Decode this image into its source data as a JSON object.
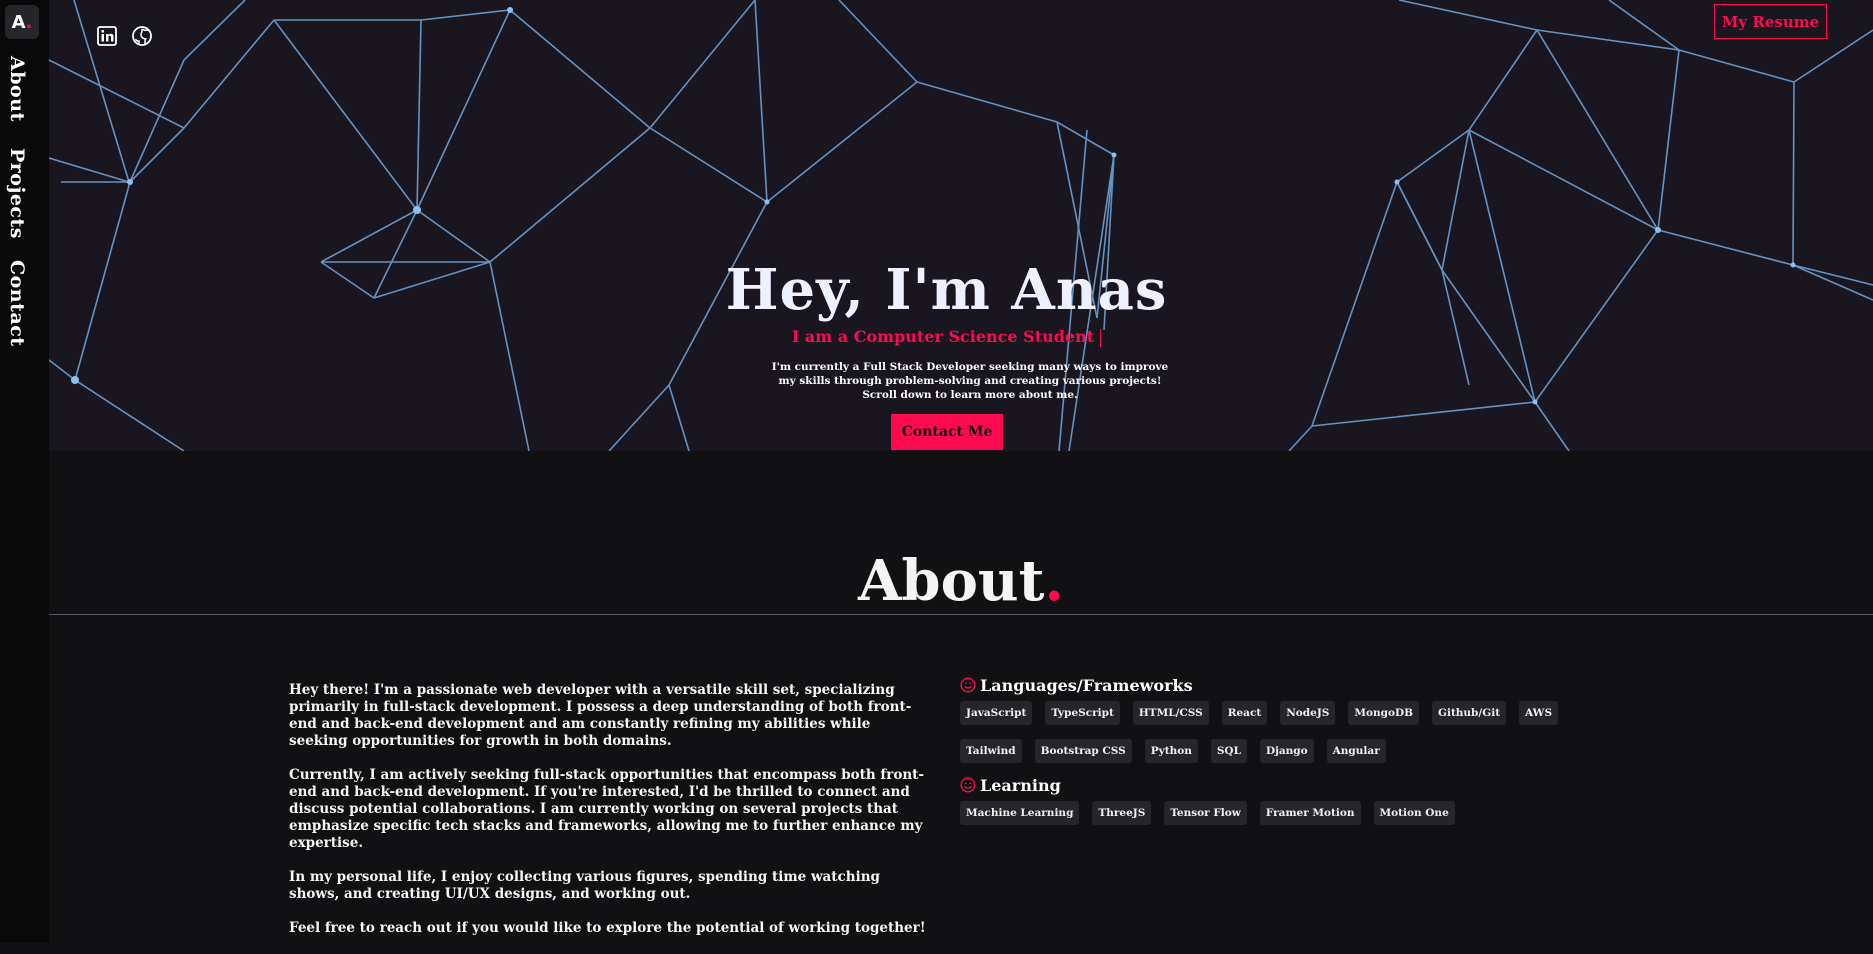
{
  "sidebar": {
    "logo_letter": "A",
    "logo_dot": ".",
    "links": [
      "About",
      "Projects",
      "Contact"
    ]
  },
  "header": {
    "resume_label": "My Resume",
    "social_icons": [
      "linkedin-icon",
      "github-icon"
    ]
  },
  "hero": {
    "title": "Hey, I'm Anas",
    "subtitle": "I am a Computer Science Student",
    "description_lines": [
      "I'm currently a Full Stack Developer seeking many ways to improve",
      "my skills through problem-solving and creating various projects!",
      "Scroll down to learn more about me."
    ],
    "contact_label": "Contact Me"
  },
  "about": {
    "title": "About",
    "title_dot": ".",
    "paragraphs": [
      "Hey there! I'm a passionate web developer with a versatile skill set, specializing primarily in full-stack development. I possess a deep understanding of both front-end and back-end development and am constantly refining my abilities while seeking opportunities for growth in both domains.",
      "Currently, I am actively seeking full-stack opportunities that encompass both front-end and back-end development. If you're interested, I'd be thrilled to connect and discuss potential collaborations. I am currently working on several projects that emphasize specific tech stacks and frameworks, allowing me to further enhance my expertise.",
      "In my personal life, I enjoy collecting various figures, spending time watching shows, and creating UI/UX designs, and working out.",
      "Feel free to reach out if you would like to explore the potential of working together!"
    ],
    "skills": {
      "languages_title": "Languages/Frameworks",
      "languages": [
        "JavaScript",
        "TypeScript",
        "HTML/CSS",
        "React",
        "NodeJS",
        "MongoDB",
        "Github/Git",
        "AWS",
        "Tailwind",
        "Bootstrap CSS",
        "Python",
        "SQL",
        "Django",
        "Angular"
      ],
      "learning_title": "Learning",
      "learning": [
        "Machine Learning",
        "ThreeJS",
        "Tensor Flow",
        "Framer Motion",
        "Motion One"
      ]
    }
  },
  "colors": {
    "accent": "#ff0a4e",
    "hero_bg": "#1a1620",
    "page_bg": "#111113",
    "network": "#7ab2e8"
  }
}
